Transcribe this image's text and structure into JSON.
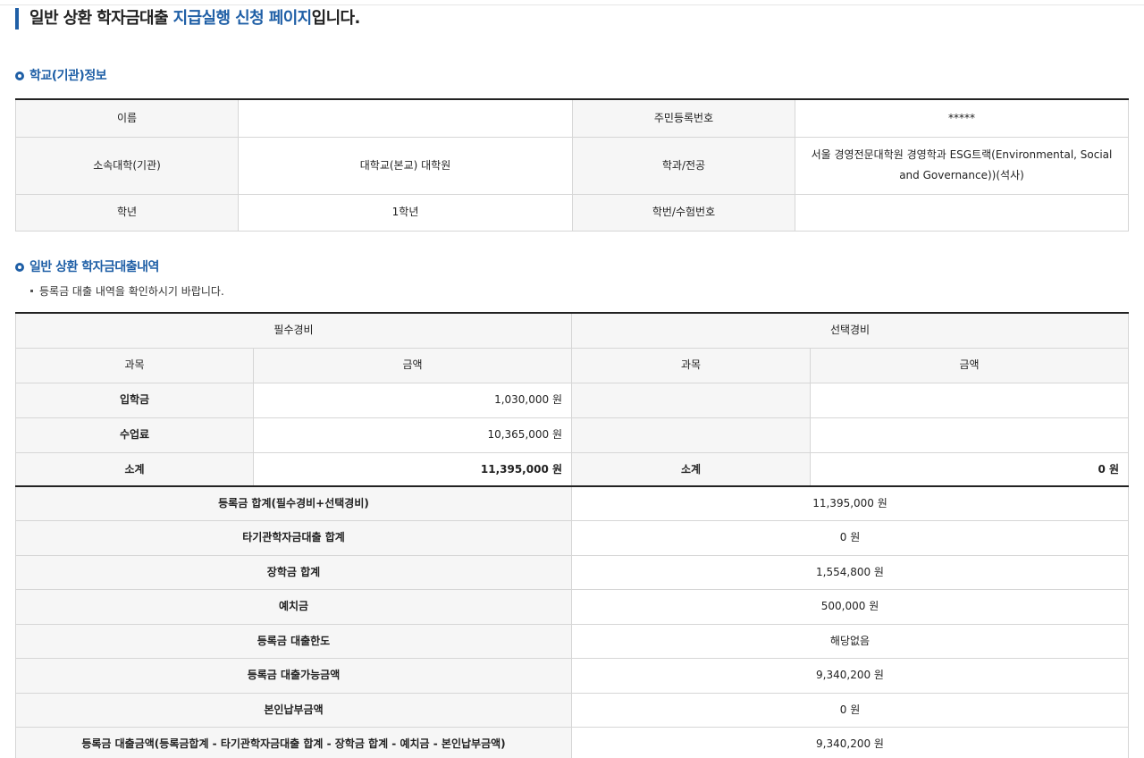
{
  "header": {
    "title_prefix": "일반 상환 학자금대출 ",
    "title_highlight": "지급실행 신청 페이지",
    "title_suffix": "입니다."
  },
  "school_section": {
    "title": "학교(기관)정보",
    "name_label": "이름",
    "name_value": "",
    "rrn_label": "주민등록번호",
    "rrn_value": "*****",
    "univ_label": "소속대학(기관)",
    "univ_value": "대학교(본교) 대학원",
    "major_label": "학과/전공",
    "major_value": "서울 경영전문대학원 경영학과 ESG트랙(Environmental, Social and Governance))(석사)",
    "grade_label": "학년",
    "grade_value": "1학년",
    "student_no_label": "학번/수험번호",
    "student_no_value": ""
  },
  "loan_section": {
    "title": "일반 상환 학자금대출내역",
    "note": "등록금 대출 내역을 확인하시기 바랍니다.",
    "required_header": "필수경비",
    "optional_header": "선택경비",
    "subject_header": "과목",
    "amount_header": "금액",
    "rows": [
      {
        "subject": "입학금",
        "amount": "1,030,000 원",
        "opt_subject": "",
        "opt_amount": ""
      },
      {
        "subject": "수업료",
        "amount": "10,365,000 원",
        "opt_subject": "",
        "opt_amount": ""
      }
    ],
    "subtotal_label": "소계",
    "subtotal_required": "11,395,000 원",
    "subtotal_optional_label": "소계",
    "subtotal_optional": "0 원"
  },
  "summary": [
    {
      "label": "등록금 합계(필수경비+선택경비)",
      "value": "11,395,000 원"
    },
    {
      "label": "타기관학자금대출 합계",
      "value": "0 원"
    },
    {
      "label": "장학금 합계",
      "value": "1,554,800 원"
    },
    {
      "label": "예치금",
      "value": "500,000 원"
    },
    {
      "label": "등록금 대출한도",
      "value": "해당없음"
    },
    {
      "label": "등록금 대출가능금액",
      "value": "9,340,200 원"
    },
    {
      "label": "본인납부금액",
      "value": "0 원"
    },
    {
      "label": "등록금 대출금액(등록금합계 - 타기관학자금대출 합계 - 장학금 합계 - 예치금 - 본인납부금액)",
      "value": "9,340,200 원"
    }
  ],
  "colors": {
    "accent": "#1f5fa6",
    "label_bg": "#f6f6f6",
    "border": "#d6d6d6"
  }
}
